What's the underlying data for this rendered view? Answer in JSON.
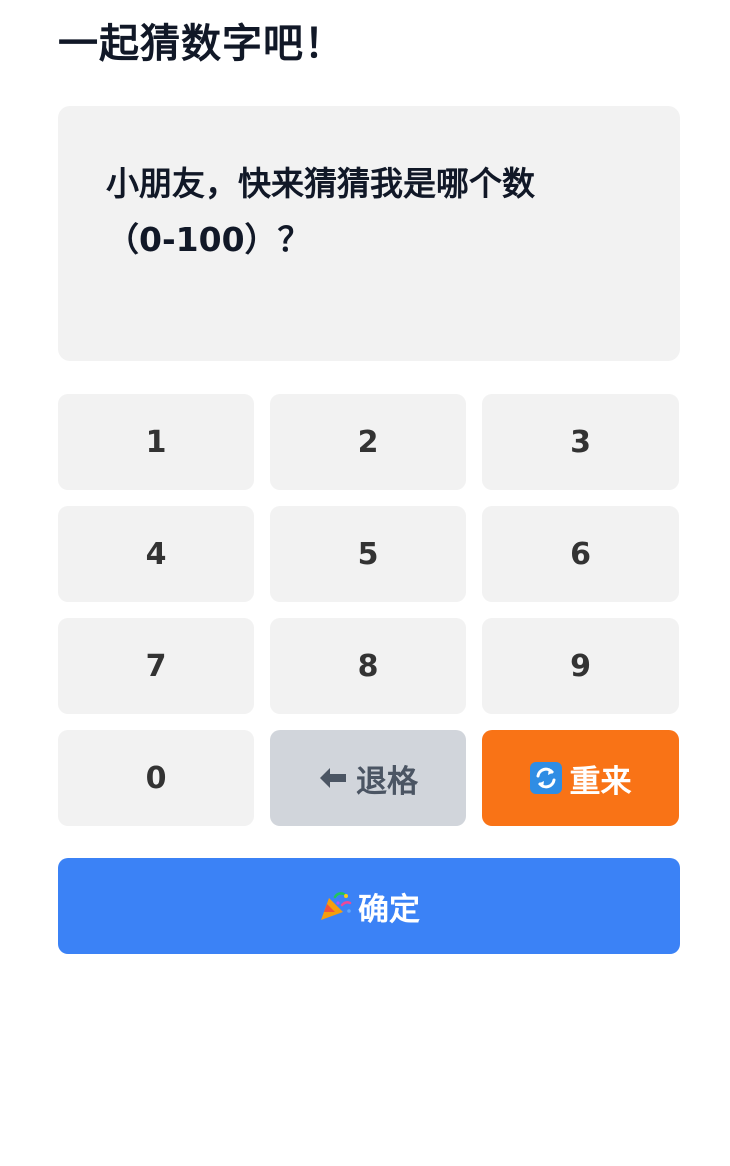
{
  "title": "一起猜数字吧！",
  "prompt": {
    "line1": "小朋友，快来猜猜我是哪个数",
    "line2": "（0-100）？"
  },
  "keypad": {
    "digits": [
      "1",
      "2",
      "3",
      "4",
      "5",
      "6",
      "7",
      "8",
      "9",
      "0"
    ],
    "backspace_label": "退格",
    "backspace_icon": "arrow-left-icon",
    "reset_label": "重来",
    "reset_icon": "refresh-icon"
  },
  "confirm": {
    "label": "确定",
    "icon": "party-popper-icon"
  },
  "colors": {
    "key_bg": "#f2f2f2",
    "backspace_bg": "#d1d5db",
    "reset_bg": "#f97316",
    "confirm_bg": "#3b82f6"
  }
}
